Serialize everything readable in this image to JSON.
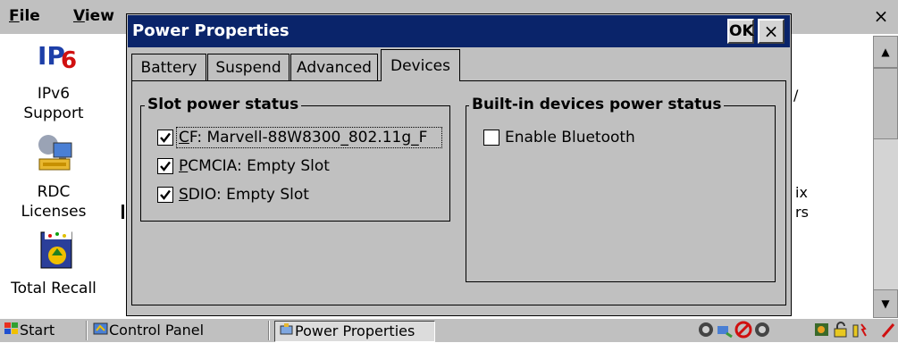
{
  "background_window": {
    "menu": {
      "file": "File",
      "file_underline": "F",
      "file_rest": "ile",
      "view": "View",
      "view_underline": "V",
      "view_rest": "iew"
    },
    "close_glyph": "×",
    "partial_text_1": "ix",
    "partial_text_2": "rs",
    "partial_text_3": "/",
    "desktop_icons": [
      {
        "name": "ipv6-icon",
        "label_line1": "IPv6",
        "label_line2": "Support"
      },
      {
        "name": "rdc-icon",
        "label_line1": "RDC",
        "label_line2": "Licenses"
      },
      {
        "name": "total-recall-icon",
        "label_line1": "Total Recall",
        "label_line2": ""
      }
    ]
  },
  "dialog": {
    "title": "Power Properties",
    "ok_label": "OK",
    "close_label": "×",
    "tabs": [
      {
        "label": "Battery",
        "active": false
      },
      {
        "label": "Suspend",
        "active": false
      },
      {
        "label": "Advanced",
        "active": false
      },
      {
        "label": "Devices",
        "active": true
      }
    ],
    "slot_group": {
      "title": "Slot power status",
      "items": [
        {
          "underline": "C",
          "rest": "F: Marvell-88W8300_802.11g_F",
          "checked": true
        },
        {
          "underline": "P",
          "rest": "CMCIA: Empty Slot",
          "checked": true
        },
        {
          "underline": "S",
          "rest": "DIO: Empty Slot",
          "checked": true
        }
      ]
    },
    "builtin_group": {
      "title": "Built-in devices power status",
      "items": [
        {
          "label": "Enable Bluetooth",
          "checked": false
        }
      ]
    }
  },
  "taskbar": {
    "start": "Start",
    "items": [
      "Control Panel",
      "Power Properties"
    ]
  },
  "colors": {
    "title_bar": "#0a246a",
    "face": "#c0c0c0"
  }
}
